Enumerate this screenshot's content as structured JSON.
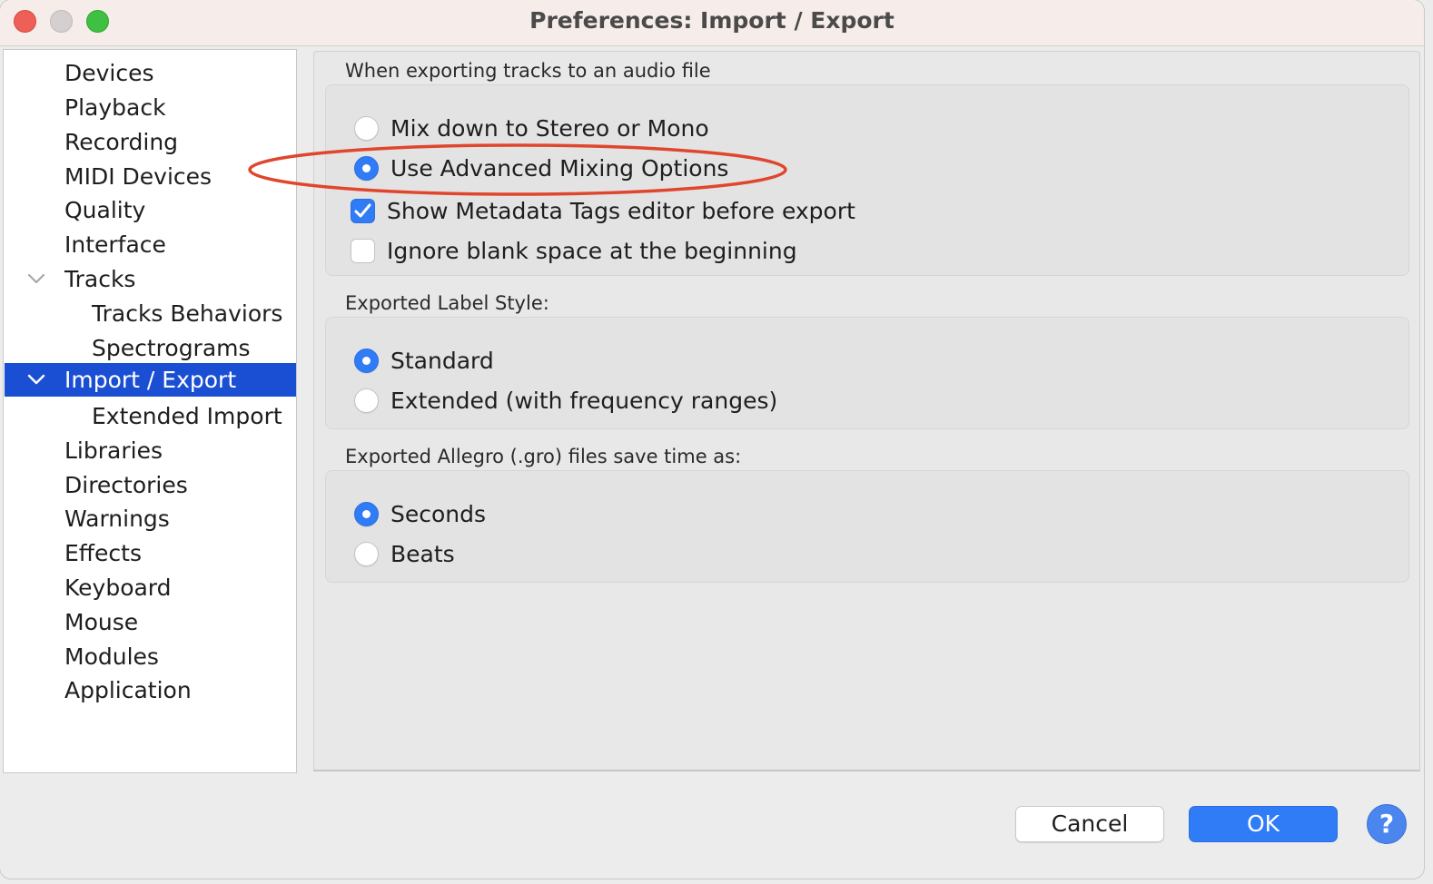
{
  "window": {
    "title": "Preferences: Import / Export"
  },
  "sidebar": {
    "items": [
      {
        "label": "Devices"
      },
      {
        "label": "Playback"
      },
      {
        "label": "Recording"
      },
      {
        "label": "MIDI Devices"
      },
      {
        "label": "Quality"
      },
      {
        "label": "Interface"
      },
      {
        "label": "Tracks",
        "expanded": true
      },
      {
        "label": "Tracks Behaviors"
      },
      {
        "label": "Spectrograms"
      },
      {
        "label": "Import / Export",
        "expanded": true,
        "selected": true
      },
      {
        "label": "Extended Import"
      },
      {
        "label": "Libraries"
      },
      {
        "label": "Directories"
      },
      {
        "label": "Warnings"
      },
      {
        "label": "Effects"
      },
      {
        "label": "Keyboard"
      },
      {
        "label": "Mouse"
      },
      {
        "label": "Modules"
      },
      {
        "label": "Application"
      }
    ]
  },
  "export_tracks": {
    "title": "When exporting tracks to an audio file",
    "options": [
      {
        "label": "Mix down to Stereo or Mono",
        "selected": false
      },
      {
        "label": "Use Advanced Mixing Options",
        "selected": true
      }
    ],
    "checkboxes": [
      {
        "label": "Show Metadata Tags editor before export",
        "checked": true
      },
      {
        "label": "Ignore blank space at the beginning",
        "checked": false
      }
    ]
  },
  "label_style": {
    "title": "Exported Label Style:",
    "options": [
      {
        "label": "Standard",
        "selected": true
      },
      {
        "label": "Extended (with frequency ranges)",
        "selected": false
      }
    ]
  },
  "allegro": {
    "title": "Exported Allegro (.gro) files save time as:",
    "options": [
      {
        "label": "Seconds",
        "selected": true
      },
      {
        "label": "Beats",
        "selected": false
      }
    ]
  },
  "footer": {
    "cancel_label": "Cancel",
    "ok_label": "OK",
    "help_label": "?"
  },
  "colors": {
    "accent": "#2f7cf6",
    "selection": "#1b4fd3",
    "annotation": "#e0452d"
  }
}
